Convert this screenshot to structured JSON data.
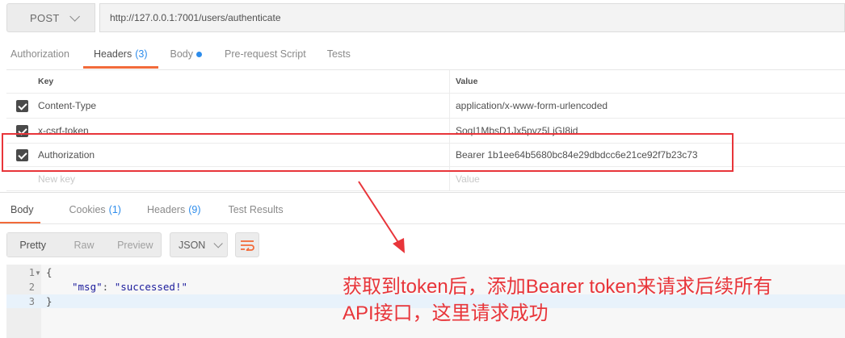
{
  "request": {
    "method": "POST",
    "url": "http://127.0.0.1:7001/users/authenticate"
  },
  "request_tabs": [
    {
      "label": "Authorization",
      "count": ""
    },
    {
      "label": "Headers",
      "count": "(3)"
    },
    {
      "label": "Body",
      "count": ""
    },
    {
      "label": "Pre-request Script",
      "count": ""
    },
    {
      "label": "Tests",
      "count": ""
    }
  ],
  "headers_table": {
    "key_header": "Key",
    "value_header": "Value",
    "rows": [
      {
        "key": "Content-Type",
        "value": "application/x-www-form-urlencoded",
        "checked": true
      },
      {
        "key": "x-csrf-token",
        "value": "SoqI1MbsD1Jx5pvz5LjGI8id",
        "checked": true
      },
      {
        "key": "Authorization",
        "value": "Bearer 1b1ee64b5680bc84e29dbdcc6e21ce92f7b23c73",
        "checked": true
      }
    ],
    "new_key_placeholder": "New key",
    "new_value_placeholder": "Value"
  },
  "response_tabs": [
    {
      "label": "Body",
      "count": ""
    },
    {
      "label": "Cookies",
      "count": "(1)"
    },
    {
      "label": "Headers",
      "count": "(9)"
    },
    {
      "label": "Test Results",
      "count": ""
    }
  ],
  "view_modes": {
    "pretty": "Pretty",
    "raw": "Raw",
    "preview": "Preview"
  },
  "format": "JSON",
  "code": {
    "line_numbers": [
      "1",
      "2",
      "3"
    ],
    "open_brace": "{",
    "key": "\"msg\"",
    "colon": ": ",
    "value": "\"successed!\"",
    "close_brace": "}"
  },
  "annotation": {
    "line1": "获取到token后，添加Bearer token来请求后续所有",
    "line2": "API接口，这里请求成功"
  },
  "colors": {
    "accent": "#f26b3a",
    "highlight": "#e8353a",
    "link": "#2d8ceb"
  }
}
